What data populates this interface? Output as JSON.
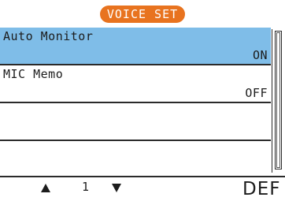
{
  "header": {
    "title": "VOICE SET"
  },
  "menu": {
    "items": [
      {
        "label": "Auto Monitor",
        "value": "ON",
        "selected": true
      },
      {
        "label": "MIC Memo",
        "value": "OFF",
        "selected": false
      },
      {
        "label": "",
        "value": "",
        "selected": false
      },
      {
        "label": "",
        "value": "",
        "selected": false
      }
    ]
  },
  "footer": {
    "page_number": "1",
    "def_label": "DEF",
    "up_icon": "triangle-up-icon",
    "down_icon": "triangle-down-icon"
  },
  "colors": {
    "title_pill": "#e8731f",
    "selected_row": "#7fbde8"
  }
}
